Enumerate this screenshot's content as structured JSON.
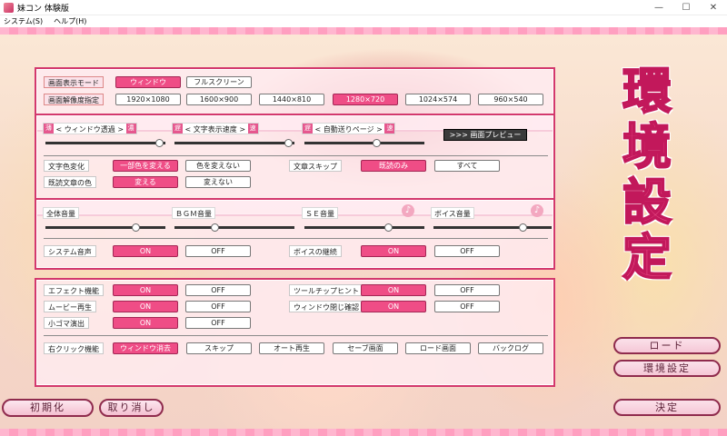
{
  "window": {
    "title": "妹コン 体験版",
    "controls": [
      "—",
      "☐",
      "✕"
    ]
  },
  "menubar": {
    "items": [
      "システム(S)",
      "ヘルプ(H)"
    ]
  },
  "display": {
    "mode_label": "画面表示モード",
    "mode_options": [
      {
        "label": "ウィンドウ",
        "on": true
      },
      {
        "label": "フルスクリーン",
        "on": false
      }
    ],
    "res_label": "画面解像度指定",
    "res_options": [
      {
        "label": "1920×1080",
        "on": false
      },
      {
        "label": "1600×900",
        "on": false
      },
      {
        "label": "1440×810",
        "on": false
      },
      {
        "label": "1280×720",
        "on": true
      },
      {
        "label": "1024×574",
        "on": false
      },
      {
        "label": "960×540",
        "on": false
      }
    ]
  },
  "text": {
    "sliders": [
      {
        "left": "薄",
        "label": "ウィンドウ透過",
        "right": "濃",
        "value": 0.95
      },
      {
        "left": "遅",
        "label": "文字表示速度",
        "right": "速",
        "value": 0.95
      },
      {
        "left": "遅",
        "label": "自動送りページ",
        "right": "速",
        "value": 0.6
      }
    ],
    "preview_label": ">>> 画面プレビュー",
    "color_change_label": "文字色変化",
    "color_change_options": [
      {
        "label": "一部色を変える",
        "on": true
      },
      {
        "label": "色を変えない",
        "on": false
      }
    ],
    "skip_label": "文章スキップ",
    "skip_options": [
      {
        "label": "既読のみ",
        "on": true
      },
      {
        "label": "すべて",
        "on": false
      }
    ],
    "read_color_label": "既読文章の色",
    "read_color_options": [
      {
        "label": "変える",
        "on": true
      },
      {
        "label": "変えない",
        "on": false
      }
    ]
  },
  "sound": {
    "sliders": [
      {
        "label": "全体音量",
        "value": 0.75,
        "icon": ""
      },
      {
        "label": "ＢＧＭ音量",
        "value": 0.33,
        "icon": ""
      },
      {
        "label": "ＳＥ音量",
        "value": 0.7,
        "icon": "♪"
      },
      {
        "label": "ボイス音量",
        "value": 0.75,
        "icon": "♪"
      }
    ],
    "system_voice_label": "システム音声",
    "system_voice_options": [
      {
        "label": "ON",
        "on": true
      },
      {
        "label": "OFF",
        "on": false
      }
    ],
    "voice_continue_label": "ボイスの継続",
    "voice_continue_options": [
      {
        "label": "ON",
        "on": true
      },
      {
        "label": "OFF",
        "on": false
      }
    ]
  },
  "effects": {
    "effect_label": "エフェクト機能",
    "effect_options": [
      {
        "label": "ON",
        "on": true
      },
      {
        "label": "OFF",
        "on": false
      }
    ],
    "tooltip_label": "ツールチップヒント",
    "tooltip_options": [
      {
        "label": "ON",
        "on": true
      },
      {
        "label": "OFF",
        "on": false
      }
    ],
    "movie_label": "ムービー再生",
    "movie_options": [
      {
        "label": "ON",
        "on": true
      },
      {
        "label": "OFF",
        "on": false
      }
    ],
    "window_label": "ウィンドウ閉じ確認",
    "window_options": [
      {
        "label": "ON",
        "on": true
      },
      {
        "label": "OFF",
        "on": false
      }
    ],
    "small_label": "小ゴマ演出",
    "small_options": [
      {
        "label": "ON",
        "on": true
      },
      {
        "label": "OFF",
        "on": false
      }
    ],
    "rclick_label": "右クリック機能",
    "rclick_options": [
      {
        "label": "ウィンドウ消去",
        "on": true
      },
      {
        "label": "スキップ",
        "on": false
      },
      {
        "label": "オート再生",
        "on": false
      },
      {
        "label": "セーブ画面",
        "on": false
      },
      {
        "label": "ロード画面",
        "on": false
      },
      {
        "label": "バックログ",
        "on": false
      }
    ]
  },
  "heading": {
    "kanji": [
      "環",
      "境",
      "設",
      "定"
    ]
  },
  "side_buttons": {
    "load": "ロード",
    "settings": "環境設定",
    "ok": "決定"
  },
  "bottom_buttons": {
    "init": "初期化",
    "cancel": "取り消し"
  },
  "colors": {
    "accent": "#ef4d86",
    "frame": "#d3386d",
    "heading": "#f25a92"
  }
}
